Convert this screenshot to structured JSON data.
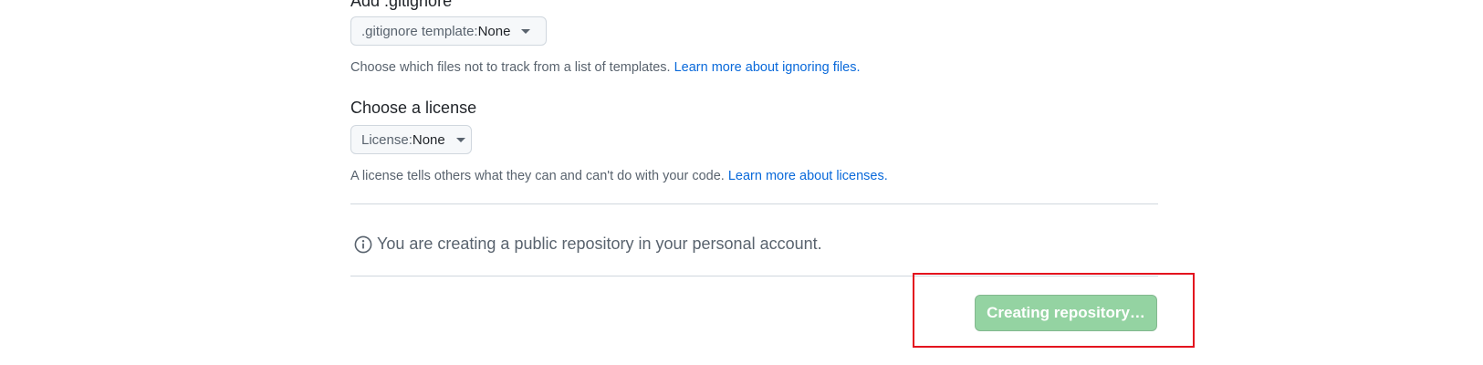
{
  "gitignore": {
    "heading": "Add .gitignore",
    "select_label": ".gitignore template:",
    "select_value": "None",
    "note_text": "Choose which files not to track from a list of templates. ",
    "note_link": "Learn more about ignoring files."
  },
  "license": {
    "heading": "Choose a license",
    "select_label": "License:",
    "select_value": "None",
    "note_text": "A license tells others what they can and can't do with your code. ",
    "note_link": "Learn more about licenses."
  },
  "info": {
    "icon": "info-icon",
    "text": "You are creating a public repository in your personal account."
  },
  "submit": {
    "label": "Creating repository…",
    "state": "disabled",
    "color": "#94d3a2"
  },
  "highlight": {
    "color": "#e3101e"
  }
}
